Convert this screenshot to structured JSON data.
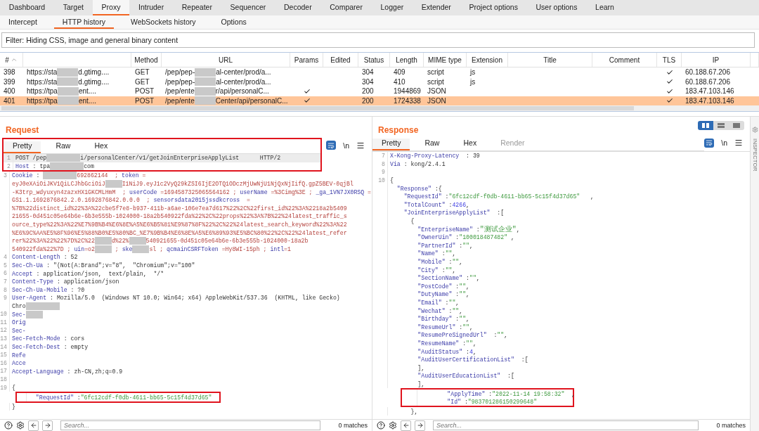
{
  "main_tabs": [
    {
      "label": "Dashboard",
      "selected": false
    },
    {
      "label": "Target",
      "selected": false
    },
    {
      "label": "Proxy",
      "selected": true
    },
    {
      "label": "Intruder",
      "selected": false
    },
    {
      "label": "Repeater",
      "selected": false
    },
    {
      "label": "Sequencer",
      "selected": false
    },
    {
      "label": "Decoder",
      "selected": false
    },
    {
      "label": "Comparer",
      "selected": false
    },
    {
      "label": "Logger",
      "selected": false
    },
    {
      "label": "Extender",
      "selected": false
    },
    {
      "label": "Project options",
      "selected": false
    },
    {
      "label": "User options",
      "selected": false
    },
    {
      "label": "Learn",
      "selected": false
    }
  ],
  "sub_tabs": [
    {
      "label": "Intercept",
      "selected": false
    },
    {
      "label": "HTTP history",
      "selected": true
    },
    {
      "label": "WebSockets history",
      "selected": false
    },
    {
      "label": "Options",
      "selected": false
    }
  ],
  "filter": "Filter: Hiding CSS, image and general binary content",
  "table": {
    "columns": [
      {
        "label": "#",
        "sorted": true
      },
      {
        "sorted": false
      },
      {
        "label": "Method",
        "sorted": false
      },
      {
        "label": "URL",
        "sorted": false
      },
      {
        "label": "Params",
        "sorted": false
      },
      {
        "label": "Edited",
        "sorted": false
      },
      {
        "label": "Status",
        "sorted": false
      },
      {
        "label": "Length",
        "sorted": false
      },
      {
        "label": "MIME type",
        "sorted": false
      },
      {
        "label": "Extension",
        "sorted": false
      },
      {
        "label": "Title",
        "sorted": false
      },
      {
        "label": "Comment",
        "sorted": false
      },
      {
        "label": "TLS",
        "sorted": false
      },
      {
        "label": "IP",
        "sorted": false
      }
    ],
    "rows": [
      {
        "number": "398",
        "host": [
          "https://sta",
          "d.gtimg...."
        ],
        "method": "GET",
        "url": [
          "/pep/pep-",
          "al-center/prod/a..."
        ],
        "params": false,
        "status": "304",
        "length": "409",
        "mime": "script",
        "extension": "js",
        "tls": true,
        "ip": "60.188.67.206",
        "selected": false
      },
      {
        "number": "399",
        "host": [
          "https://sta",
          "d.gtimg...."
        ],
        "method": "GET",
        "url": [
          "/pep/pep-",
          "al-center/prod/a..."
        ],
        "params": false,
        "status": "304",
        "length": "410",
        "mime": "script",
        "extension": "js",
        "tls": true,
        "ip": "60.188.67.206",
        "selected": false
      },
      {
        "number": "400",
        "host": [
          "https://tpa",
          "ent...."
        ],
        "method": "POST",
        "url": [
          "/pep/ente",
          "r/api/personalC..."
        ],
        "params": true,
        "status": "200",
        "length": "1944869",
        "mime": "JSON",
        "tls": true,
        "ip": "183.47.103.146",
        "selected": false
      },
      {
        "number": "401",
        "host": [
          "https://tpa",
          "ent...."
        ],
        "method": "POST",
        "url": [
          "/pep/ente",
          "Center/api/personalC..."
        ],
        "params": true,
        "status": "200",
        "length": "1724338",
        "mime": "JSON",
        "tls": true,
        "ip": "183.47.103.146",
        "selected": true
      }
    ]
  },
  "request": {
    "title": "Request",
    "tabs_boxed": true,
    "tabs": [
      {
        "label": "Pretty",
        "selected": true,
        "disabled": false
      },
      {
        "label": "Raw",
        "selected": false,
        "disabled": false
      },
      {
        "label": "Hex",
        "selected": false,
        "disabled": false
      }
    ],
    "newline_button": "\\n",
    "search_placeholder": "Search...",
    "matches": "0 matches",
    "lines": [
      {
        "num": "1",
        "boxed": true,
        "current": true,
        "segments": [
          {
            "kind": "text",
            "text": "POST /pep"
          },
          {
            "kind": "redacted"
          },
          {
            "kind": "redacted"
          },
          {
            "kind": "text",
            "text": "i/personalCenter/v1/getJoinEnterpriseApplyList"
          },
          {
            "kind": "text",
            "text": "      HTTP/2"
          }
        ]
      },
      {
        "num": "2",
        "boxed": true,
        "segments": [
          {
            "kind": "key",
            "text": "Host"
          },
          {
            "kind": "text",
            "text": " : tpa"
          },
          {
            "kind": "redacted"
          },
          {
            "kind": "redacted"
          },
          {
            "kind": "text",
            "text": "com"
          }
        ]
      },
      {
        "num": "3",
        "segments": [
          {
            "kind": "key",
            "text": "Cookie"
          },
          {
            "kind": "text",
            "text": " : "
          },
          {
            "kind": "redacted"
          },
          {
            "kind": "redacted"
          },
          {
            "kind": "cookie",
            "text": "692862144  ; "
          },
          {
            "kind": "key",
            "text": "token"
          },
          {
            "kind": "cookie",
            "text": " ="
          }
        ]
      },
      {
        "segments": [
          {
            "kind": "cookie",
            "text": "eyJ0eXAiOiJKV1QiLCJhbGciOiJ"
          },
          {
            "kind": "redacted"
          },
          {
            "kind": "cookie",
            "text": "I1NiJ9.eyJ1c2VyQ29kZSI6IjE2OTQ1ODczMjUwNjU1NjQxNjIifQ.gpZ5BEV-0qjBl"
          }
        ]
      },
      {
        "segments": [
          {
            "kind": "cookie",
            "text": "-K3trp_wdyuxyn4zazxHX1GKCMLHmM  ; "
          },
          {
            "kind": "key",
            "text": "userCode"
          },
          {
            "kind": "cookie",
            "text": " =1694587325065564162 ; "
          },
          {
            "kind": "key",
            "text": "userName"
          },
          {
            "kind": "cookie",
            "text": " =%3Cimg%3E ; "
          },
          {
            "kind": "key",
            "text": "_ga_1VN7JX0RSQ"
          },
          {
            "kind": "cookie",
            "text": " ="
          }
        ]
      },
      {
        "segments": [
          {
            "kind": "cookie",
            "text": "GS1.1.1692876842.2.0.1692876842.0.0.0  ; "
          },
          {
            "kind": "key",
            "text": "sensorsdata2015jssdkcross"
          },
          {
            "kind": "cookie",
            "text": "  ="
          }
        ]
      },
      {
        "segments": [
          {
            "kind": "cookie",
            "text": "%7B%22distinct_id%22%3A%22cbe5f7e8-b937-411b-a6ae-106e7ea7d617%22%2C%22first_id%22%3A%2218a2b5409"
          }
        ]
      },
      {
        "segments": [
          {
            "kind": "cookie",
            "text": "21655-0d451c05e64b6e-6b3e555b-1024000-18a2b540922fda%22%2C%22props%22%3A%7B%22%24latest_traffic_s"
          }
        ]
      },
      {
        "segments": [
          {
            "kind": "cookie",
            "text": "ource_type%22%3A%22%E7%9B%B4%E6%8E%A5%E6%B5%81%E9%87%8F%22%2C%22%24latest_search_keyword%22%3A%22"
          }
        ]
      },
      {
        "segments": [
          {
            "kind": "cookie",
            "text": "%E6%9C%AA%E5%8F%96%E5%88%B0%E5%80%BC_%E7%9B%B4%E6%8E%A5%E6%89%93%E5%BC%80%22%2C%22%24latest_refer"
          }
        ]
      },
      {
        "segments": [
          {
            "kind": "cookie",
            "text": "rer%22%3A%22%22%7D%2C%22"
          },
          {
            "kind": "redacted"
          },
          {
            "kind": "cookie",
            "text": "d%22%"
          },
          {
            "kind": "redacted"
          },
          {
            "kind": "cookie",
            "text": "540921655-0d451c05e64b6e-6b3e555b-1024000-18a2b"
          }
        ]
      },
      {
        "segments": [
          {
            "kind": "cookie",
            "text": "540922fda%22%7D ; "
          },
          {
            "kind": "key",
            "text": "uin"
          },
          {
            "kind": "cookie",
            "text": "=o2"
          },
          {
            "kind": "redacted"
          },
          {
            "kind": "cookie",
            "text": " ; "
          },
          {
            "kind": "key",
            "text": "ske"
          },
          {
            "kind": "redacted"
          },
          {
            "kind": "cookie",
            "text": "sl ; "
          },
          {
            "kind": "key",
            "text": "qcmainCSRFToken"
          },
          {
            "kind": "cookie",
            "text": " =Hy8WI-15ph ; "
          },
          {
            "kind": "key",
            "text": "intl"
          },
          {
            "kind": "cookie",
            "text": "=1"
          }
        ]
      },
      {
        "num": "4",
        "segments": [
          {
            "kind": "key",
            "text": "Content-Length"
          },
          {
            "kind": "text",
            "text": " : 52"
          }
        ]
      },
      {
        "num": "5",
        "segments": [
          {
            "kind": "key",
            "text": "Sec-Ch-Ua"
          },
          {
            "kind": "text",
            "text": " : \"(Not(A:Brand\";v=\"8\",  \"Chromium\";v=\"100\""
          }
        ]
      },
      {
        "num": "6",
        "segments": [
          {
            "kind": "key",
            "text": "Accept"
          },
          {
            "kind": "text",
            "text": " : application/json,  text/plain,  */*"
          }
        ]
      },
      {
        "num": "7",
        "segments": [
          {
            "kind": "key",
            "text": "Content-Type"
          },
          {
            "kind": "text",
            "text": " : application/json"
          }
        ]
      },
      {
        "num": "8",
        "segments": [
          {
            "kind": "key",
            "text": "Sec-Ch-Ua-Mobile"
          },
          {
            "kind": "text",
            "text": " : ?0"
          }
        ]
      },
      {
        "num": "9",
        "segments": [
          {
            "kind": "key",
            "text": "User-Agent"
          },
          {
            "kind": "text",
            "text": " : Mozilla/5.0  (Windows NT 10.0; Win64; x64) AppleWebKit/537.36  (KHTML, like Gecko)"
          }
        ]
      },
      {
        "segments": [
          {
            "kind": "text",
            "text": "Chro"
          },
          {
            "kind": "redacted"
          },
          {
            "kind": "redacted"
          }
        ]
      },
      {
        "num": "10",
        "segments": [
          {
            "kind": "key",
            "text": "Sec-"
          },
          {
            "kind": "redacted"
          }
        ]
      },
      {
        "num": "11",
        "segments": [
          {
            "kind": "key",
            "text": "Orig"
          }
        ]
      },
      {
        "num": "12",
        "segments": [
          {
            "kind": "key",
            "text": "Sec-"
          }
        ]
      },
      {
        "num": "13",
        "segments": [
          {
            "kind": "key",
            "text": "Sec-Fetch-Mode"
          },
          {
            "kind": "text",
            "text": " : cors"
          }
        ]
      },
      {
        "num": "14",
        "segments": [
          {
            "kind": "key",
            "text": "Sec-Fetch-Dest"
          },
          {
            "kind": "text",
            "text": " : empty"
          }
        ]
      },
      {
        "num": "15",
        "segments": [
          {
            "kind": "key",
            "text": "Refe"
          }
        ]
      },
      {
        "num": "16",
        "segments": [
          {
            "kind": "key",
            "text": "Acce"
          }
        ]
      },
      {
        "num": "17",
        "segments": [
          {
            "kind": "key",
            "text": "Accept-Language"
          },
          {
            "kind": "text",
            "text": " : zh-CN,zh;q=0.9"
          }
        ]
      },
      {
        "num": "18"
      },
      {
        "num": "19",
        "segments": [
          {
            "kind": "text",
            "text": "{"
          }
        ]
      },
      {
        "boxed": true,
        "segments": [
          {
            "kind": "key",
            "text": "  \"RequestId\""
          },
          {
            "kind": "text",
            "text": " :"
          },
          {
            "kind": "string",
            "text": "\"6fc12cdf-f0db-4611-bb65-5c15f4d37d65\""
          }
        ]
      },
      {
        "segments": [
          {
            "kind": "text",
            "text": "}"
          }
        ]
      }
    ]
  },
  "response": {
    "title": "Response",
    "view_toggles": [
      {
        "kind": "columns",
        "selected": true
      },
      {
        "kind": "rows",
        "selected": false
      },
      {
        "kind": "single",
        "selected": false
      }
    ],
    "tabs": [
      {
        "label": "Pretty",
        "selected": true,
        "disabled": false
      },
      {
        "label": "Raw",
        "selected": false,
        "disabled": false
      },
      {
        "label": "Hex",
        "selected": false,
        "disabled": false
      },
      {
        "label": "Render",
        "selected": false,
        "disabled": true
      }
    ],
    "newline_button": "\\n",
    "search_placeholder": "Search...",
    "matches": "0 matches",
    "lines": [
      {
        "num": "7",
        "segments": [
          {
            "kind": "key",
            "text": "X-Kong-Proxy-Latency"
          },
          {
            "kind": "text",
            "text": "  : 39"
          }
        ]
      },
      {
        "num": "8",
        "segments": [
          {
            "kind": "key",
            "text": "Via"
          },
          {
            "kind": "text",
            "text": " : kong/2.4.1"
          }
        ]
      },
      {
        "num": "9"
      },
      {
        "num": "10",
        "segments": [
          {
            "kind": "text",
            "text": "{"
          }
        ]
      },
      {
        "segments": [
          {
            "kind": "key",
            "text": "  \"Response\""
          },
          {
            "kind": "text",
            "text": " :{"
          }
        ]
      },
      {
        "segments": [
          {
            "kind": "key",
            "text": "    \"RequestId\""
          },
          {
            "kind": "text",
            "text": " :"
          },
          {
            "kind": "string",
            "text": "\"6fc12cdf-f0db-4611-bb65-5c15f4d37d65\""
          },
          {
            "kind": "text",
            "text": "   ,"
          }
        ]
      },
      {
        "segments": [
          {
            "kind": "key",
            "text": "    \"TotalCount\""
          },
          {
            "kind": "text",
            "text": " :"
          },
          {
            "kind": "number",
            "text": "4266"
          },
          {
            "kind": "text",
            "text": ","
          }
        ]
      },
      {
        "segments": [
          {
            "kind": "key",
            "text": "    \"JoinEnterpriseApplyList\""
          },
          {
            "kind": "text",
            "text": "  :["
          }
        ]
      },
      {
        "segments": [
          {
            "kind": "text",
            "text": "      {"
          }
        ]
      },
      {
        "segments": [
          {
            "kind": "key",
            "text": "        \"EnterpriseName\""
          },
          {
            "kind": "text",
            "text": " :"
          },
          {
            "kind": "string",
            "text": "\"测试企业\""
          },
          {
            "kind": "text",
            "text": ","
          }
        ]
      },
      {
        "segments": [
          {
            "kind": "key",
            "text": "        \"OwnerUin\""
          },
          {
            "kind": "text",
            "text": " :"
          },
          {
            "kind": "string",
            "text": "\"100018487482\""
          },
          {
            "kind": "text",
            "text": " ,"
          }
        ]
      },
      {
        "segments": [
          {
            "kind": "key",
            "text": "        \"PartnerId\""
          },
          {
            "kind": "text",
            "text": " :"
          },
          {
            "kind": "string",
            "text": "\"\""
          },
          {
            "kind": "text",
            "text": ","
          }
        ]
      },
      {
        "segments": [
          {
            "kind": "key",
            "text": "        \"Name\""
          },
          {
            "kind": "text",
            "text": " :"
          },
          {
            "kind": "string",
            "text": "\"\""
          },
          {
            "kind": "text",
            "text": ","
          }
        ]
      },
      {
        "segments": [
          {
            "kind": "key",
            "text": "        \"Mobile\""
          },
          {
            "kind": "text",
            "text": " :"
          },
          {
            "kind": "string",
            "text": "\"\""
          },
          {
            "kind": "text",
            "text": ","
          }
        ]
      },
      {
        "segments": [
          {
            "kind": "key",
            "text": "        \"City\""
          },
          {
            "kind": "text",
            "text": " :"
          },
          {
            "kind": "string",
            "text": "\"\""
          },
          {
            "kind": "text",
            "text": ","
          }
        ]
      },
      {
        "segments": [
          {
            "kind": "key",
            "text": "        \"SectionName\""
          },
          {
            "kind": "text",
            "text": " :"
          },
          {
            "kind": "string",
            "text": "\"\""
          },
          {
            "kind": "text",
            "text": ","
          }
        ]
      },
      {
        "segments": [
          {
            "kind": "key",
            "text": "        \"PostCode\""
          },
          {
            "kind": "text",
            "text": " :"
          },
          {
            "kind": "string",
            "text": "\"\""
          },
          {
            "kind": "text",
            "text": ","
          }
        ]
      },
      {
        "segments": [
          {
            "kind": "key",
            "text": "        \"DutyName\""
          },
          {
            "kind": "text",
            "text": " :"
          },
          {
            "kind": "string",
            "text": "\"\""
          },
          {
            "kind": "text",
            "text": ","
          }
        ]
      },
      {
        "segments": [
          {
            "kind": "key",
            "text": "        \"Email\""
          },
          {
            "kind": "text",
            "text": " :"
          },
          {
            "kind": "string",
            "text": "\"\""
          },
          {
            "kind": "text",
            "text": ","
          }
        ]
      },
      {
        "segments": [
          {
            "kind": "key",
            "text": "        \"Wechat\""
          },
          {
            "kind": "text",
            "text": " :"
          },
          {
            "kind": "string",
            "text": "\"\""
          },
          {
            "kind": "text",
            "text": ","
          }
        ]
      },
      {
        "segments": [
          {
            "kind": "key",
            "text": "        \"Birthday\""
          },
          {
            "kind": "text",
            "text": " :"
          },
          {
            "kind": "string",
            "text": "\"\""
          },
          {
            "kind": "text",
            "text": ","
          }
        ]
      },
      {
        "segments": [
          {
            "kind": "key",
            "text": "        \"ResumeUrl\""
          },
          {
            "kind": "text",
            "text": " :"
          },
          {
            "kind": "string",
            "text": "\"\""
          },
          {
            "kind": "text",
            "text": ","
          }
        ]
      },
      {
        "segments": [
          {
            "kind": "key",
            "text": "        \"ResumePreSignedUrl\""
          },
          {
            "kind": "text",
            "text": "  :"
          },
          {
            "kind": "string",
            "text": "\"\""
          },
          {
            "kind": "text",
            "text": ","
          }
        ]
      },
      {
        "segments": [
          {
            "kind": "key",
            "text": "        \"ResumeName\""
          },
          {
            "kind": "text",
            "text": " :"
          },
          {
            "kind": "string",
            "text": "\"\""
          },
          {
            "kind": "text",
            "text": ","
          }
        ]
      },
      {
        "segments": [
          {
            "kind": "key",
            "text": "        \"AuditStatus\""
          },
          {
            "kind": "text",
            "text": " :"
          },
          {
            "kind": "number",
            "text": "4"
          },
          {
            "kind": "text",
            "text": ","
          }
        ]
      },
      {
        "segments": [
          {
            "kind": "key",
            "text": "        \"AuditUserCertificationList\""
          },
          {
            "kind": "text",
            "text": "  :["
          }
        ]
      },
      {
        "segments": [
          {
            "kind": "text",
            "text": "        ],"
          }
        ]
      },
      {
        "segments": [
          {
            "kind": "key",
            "text": "        \"AuditUserEducationList\""
          },
          {
            "kind": "text",
            "text": "  :["
          }
        ]
      },
      {
        "segments": [
          {
            "kind": "text",
            "text": "        ],"
          }
        ]
      },
      {
        "boxed": true,
        "segments": [
          {
            "kind": "key",
            "text": "        \"ApplyTime\""
          },
          {
            "kind": "text",
            "text": " :"
          },
          {
            "kind": "string",
            "text": "\"2022-11-14 19:58:32\""
          },
          {
            "kind": "text",
            "text": "  ,"
          }
        ]
      },
      {
        "boxed": true,
        "segments": [
          {
            "kind": "key",
            "text": "        \"Id\""
          },
          {
            "kind": "text",
            "text": " :"
          },
          {
            "kind": "string",
            "text": "\"983701286150299648\""
          }
        ]
      },
      {
        "segments": [
          {
            "kind": "text",
            "text": "      },"
          }
        ]
      }
    ]
  },
  "inspector": {
    "label": "INSPECTOR"
  }
}
